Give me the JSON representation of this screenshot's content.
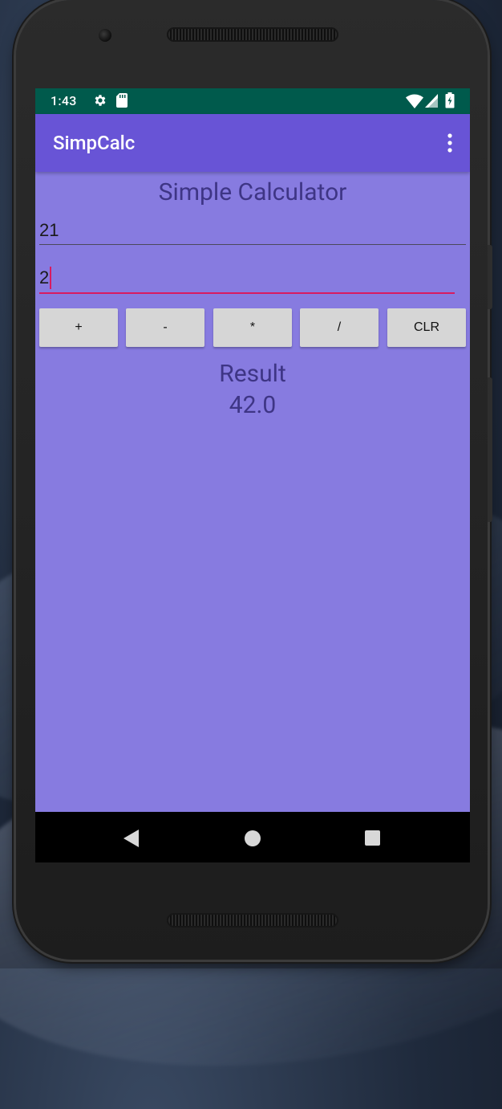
{
  "status_bar": {
    "time": "1:43",
    "icons": [
      "gear-icon",
      "sd-card-icon",
      "wifi-icon",
      "signal-icon",
      "battery-icon"
    ],
    "color": "#005a4c"
  },
  "app_bar": {
    "title": "SimpCalc",
    "overflow_icon": "overflow-menu-icon",
    "color": "#6854d6"
  },
  "main": {
    "background": "#877be0",
    "heading": "Simple Calculator",
    "input_one": {
      "value": "21"
    },
    "input_two": {
      "value": "2"
    },
    "buttons": [
      "+",
      "-",
      "*",
      "/",
      "CLR"
    ],
    "result_label": "Result",
    "result_value": "42.0",
    "accent_color": "#d81b60"
  },
  "nav_bar": {
    "icons": [
      "back-icon",
      "home-icon",
      "recents-icon"
    ]
  }
}
